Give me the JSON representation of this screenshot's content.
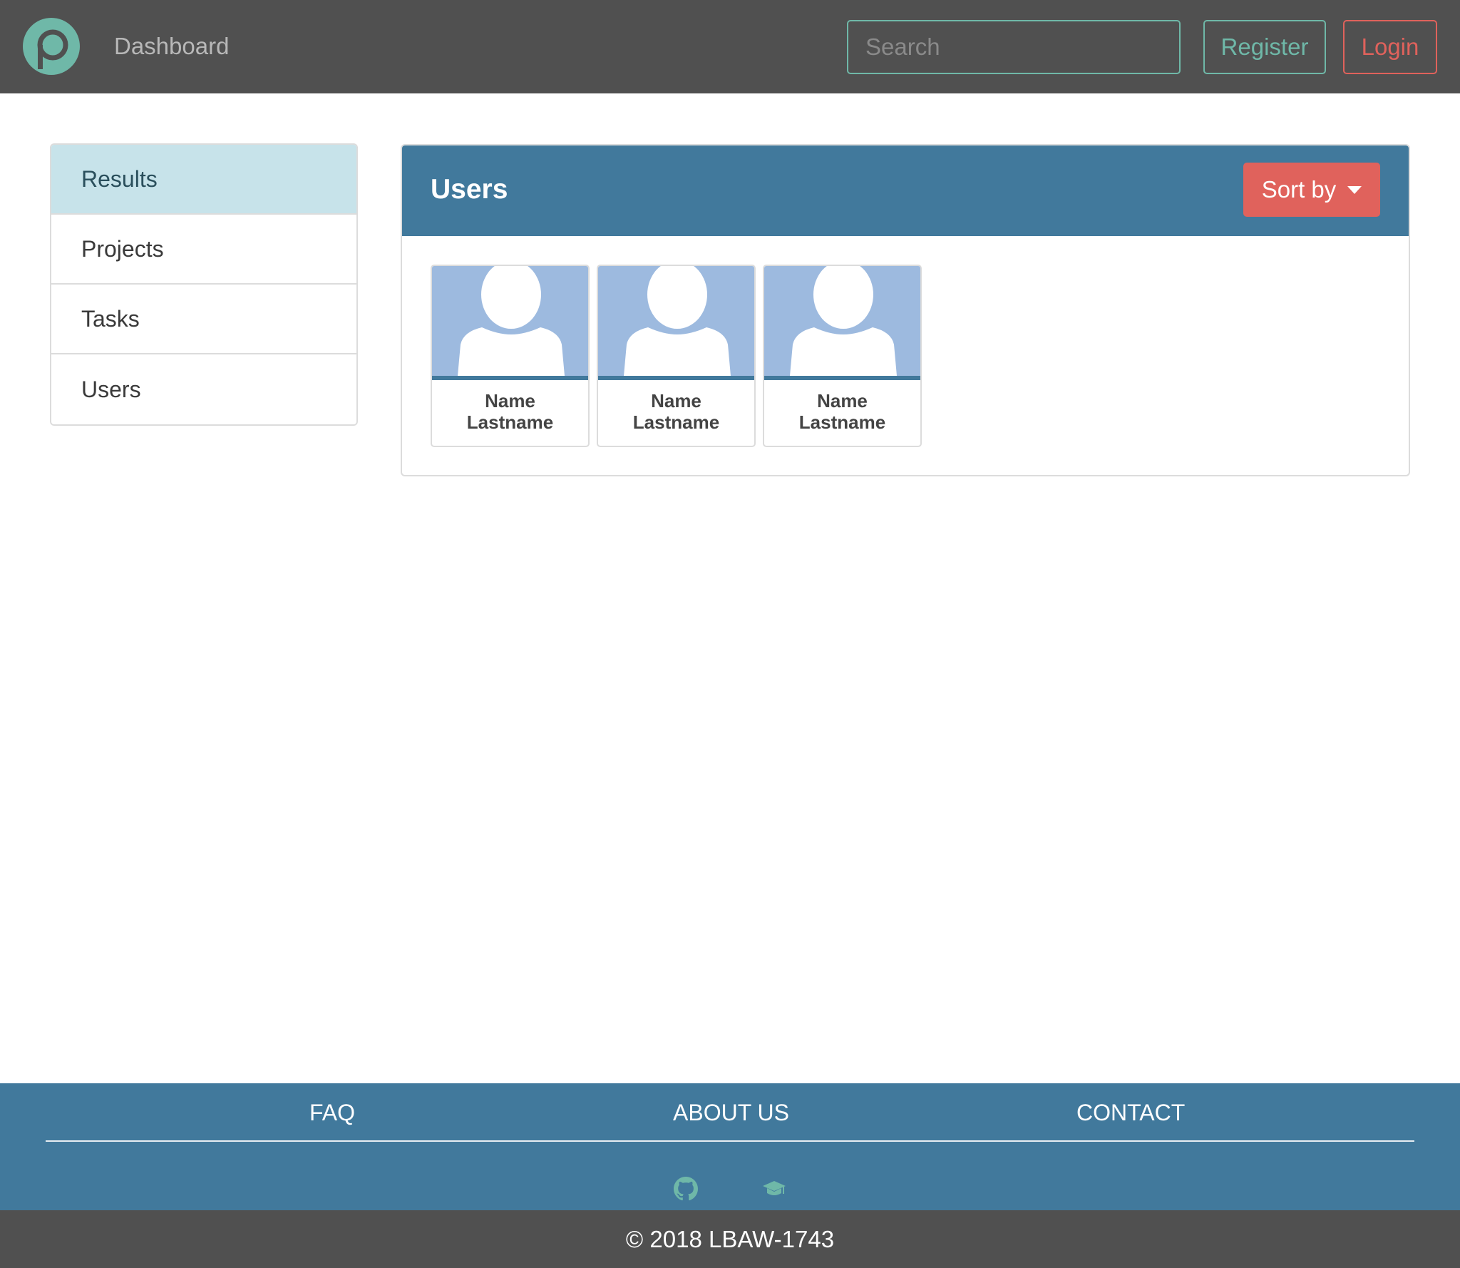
{
  "navbar": {
    "brand": "Dashboard",
    "search_placeholder": "Search",
    "register_label": "Register",
    "login_label": "Login",
    "accent_color": "#6fb8a8",
    "danger_color": "#e0625c"
  },
  "sidebar": {
    "items": [
      {
        "label": "Results",
        "active": true
      },
      {
        "label": "Projects",
        "active": false
      },
      {
        "label": "Tasks",
        "active": false
      },
      {
        "label": "Users",
        "active": false
      }
    ]
  },
  "main": {
    "title": "Users",
    "sort_label": "Sort by",
    "header_color": "#41799c",
    "users": [
      {
        "first": "Name",
        "last": "Lastname"
      },
      {
        "first": "Name",
        "last": "Lastname"
      },
      {
        "first": "Name",
        "last": "Lastname"
      }
    ]
  },
  "footer": {
    "links": [
      "FAQ",
      "ABOUT US",
      "CONTACT"
    ],
    "icons": [
      "github-icon",
      "graduation-cap-icon"
    ],
    "copyright": "© 2018 LBAW-1743"
  }
}
